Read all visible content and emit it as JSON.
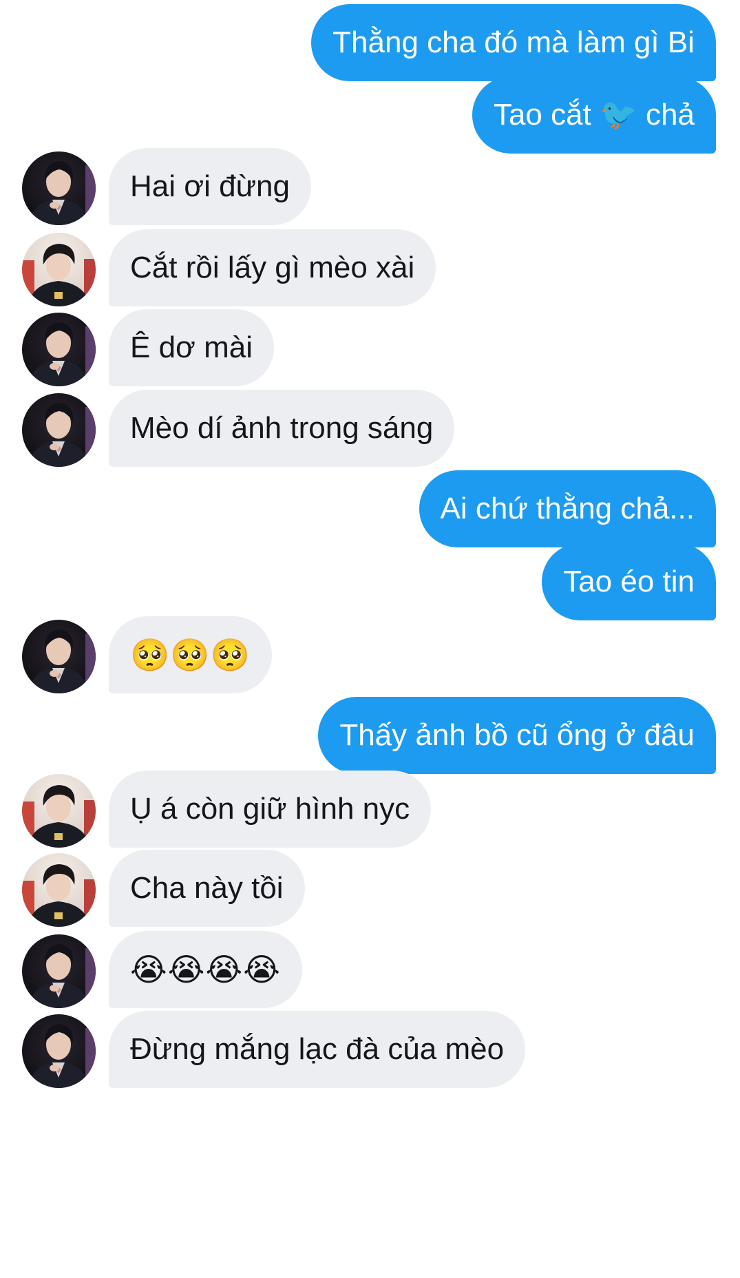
{
  "conversation": {
    "messages": [
      {
        "side": "out",
        "text": "Thằng cha đó mà làm gì Bi"
      },
      {
        "side": "out",
        "text": "Tao cắt 🐦 chả"
      },
      {
        "side": "in",
        "avatar": "dark-avatar",
        "text": "Hai ơi đừng"
      },
      {
        "side": "in",
        "avatar": "light-avatar",
        "text": "Cắt rồi lấy gì mèo xài"
      },
      {
        "side": "in",
        "avatar": "dark-avatar",
        "text": "Ê dơ mài"
      },
      {
        "side": "in",
        "avatar": "dark-avatar",
        "text": "Mèo dí ảnh trong sáng"
      },
      {
        "side": "out",
        "text": "Ai chứ thằng chả..."
      },
      {
        "side": "out",
        "text": "Tao éo tin"
      },
      {
        "side": "in",
        "avatar": "dark-avatar",
        "text": "🥺🥺🥺"
      },
      {
        "side": "out",
        "text": "Thấy ảnh bồ cũ ổng ở đâu"
      },
      {
        "side": "in",
        "avatar": "light-avatar",
        "text": "Ụ á còn giữ hình nyc"
      },
      {
        "side": "in",
        "avatar": "light-avatar",
        "text": "Cha này tồi"
      },
      {
        "side": "in",
        "avatar": "dark-avatar",
        "text": "😭😭😭😭"
      },
      {
        "side": "in",
        "avatar": "dark-avatar",
        "text": "Đừng mắng lạc đà của mèo"
      }
    ]
  },
  "colors": {
    "outgoing_bubble": "#1d9bf0",
    "incoming_bubble": "#eceef1",
    "outgoing_text": "#ffffff",
    "incoming_text": "#14171a"
  }
}
